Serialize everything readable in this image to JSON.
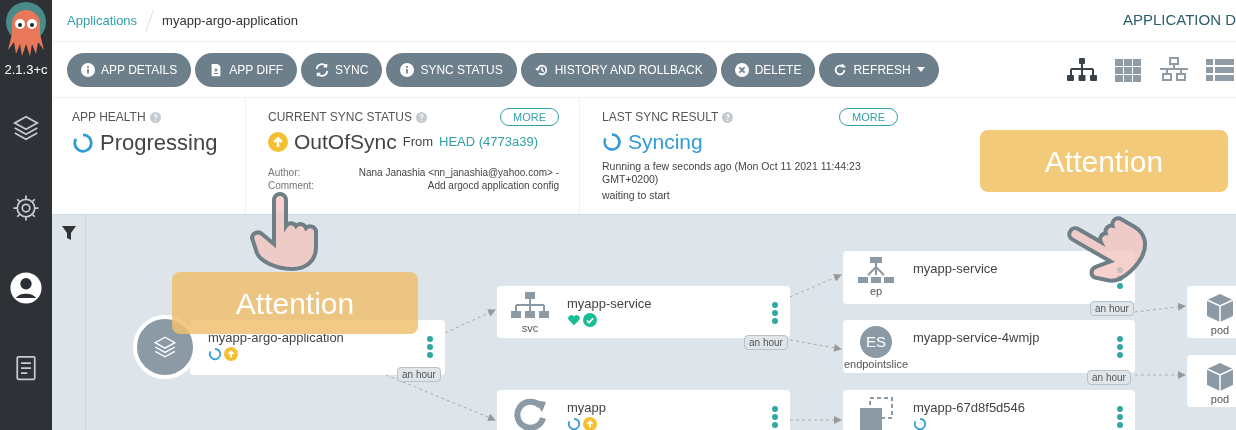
{
  "sidebar": {
    "version": "2.1.3+c",
    "items": [
      {
        "kind": "layers",
        "selected": false
      },
      {
        "kind": "settings",
        "selected": false
      },
      {
        "kind": "user",
        "selected": true
      },
      {
        "kind": "docs",
        "selected": false
      }
    ]
  },
  "breadcrumb": {
    "root": "Applications",
    "current": "myapp-argo-application"
  },
  "page_title": "APPLICATION D",
  "toolbar": [
    {
      "kind": "info",
      "label": "APP DETAILS"
    },
    {
      "kind": "diff",
      "label": "APP DIFF"
    },
    {
      "kind": "sync",
      "label": "SYNC"
    },
    {
      "kind": "info",
      "label": "SYNC STATUS"
    },
    {
      "kind": "history",
      "label": "HISTORY AND ROLLBACK"
    },
    {
      "kind": "delete",
      "label": "DELETE"
    },
    {
      "kind": "refresh",
      "label": "REFRESH"
    }
  ],
  "views": [
    {
      "kind": "tree",
      "selected": true
    },
    {
      "kind": "pods",
      "selected": false
    },
    {
      "kind": "network",
      "selected": false
    },
    {
      "kind": "list",
      "selected": false
    }
  ],
  "app_health": {
    "title": "APP HEALTH",
    "status": "Progressing",
    "kind": "progressing"
  },
  "sync_status": {
    "title": "CURRENT SYNC STATUS",
    "more": "MORE",
    "status": "OutOfSync",
    "from": "From",
    "revision": "HEAD (4773a39)",
    "author_label": "Author:",
    "author": "Nana Janashia <nn_janashia@yahoo.com> -",
    "comment_label": "Comment:",
    "comment": "Add argocd application config"
  },
  "last_sync": {
    "title": "LAST SYNC RESULT",
    "more": "MORE",
    "status": "Syncing",
    "detail": "Running a few seconds ago (Mon Oct 11 2021 11:44:23 GMT+0200)",
    "message": "waiting to start"
  },
  "nodes": [
    {
      "kind": "application",
      "name": "myapp-argo-application",
      "statuses": [
        {
          "kind": "progressing"
        },
        {
          "kind": "out_of_sync"
        }
      ],
      "age": "an hour"
    },
    {
      "kind": "svc",
      "type_label": "svc",
      "name": "myapp-service",
      "statuses": [
        {
          "kind": "healthy"
        },
        {
          "kind": "synced"
        }
      ],
      "age": "an hour"
    },
    {
      "kind": "deploy",
      "name": "myapp",
      "statuses": [
        {
          "kind": "progressing"
        },
        {
          "kind": "out_of_sync"
        }
      ]
    },
    {
      "kind": "ep",
      "type_label": "ep",
      "name": "myapp-service",
      "age": "an hour"
    },
    {
      "kind": "endpointslice",
      "type_label": "endpointslice",
      "badge": "ES",
      "name": "myapp-service-4wmjp",
      "age": "an hour"
    },
    {
      "kind": "rs",
      "name": "myapp-67d8f5d546",
      "statuses": [
        {
          "kind": "progressing"
        }
      ]
    },
    {
      "kind": "pod",
      "type_label": "pod"
    },
    {
      "kind": "pod",
      "type_label": "pod"
    }
  ],
  "overlays": [
    {
      "text": "Attention"
    },
    {
      "text": "Attention"
    }
  ]
}
